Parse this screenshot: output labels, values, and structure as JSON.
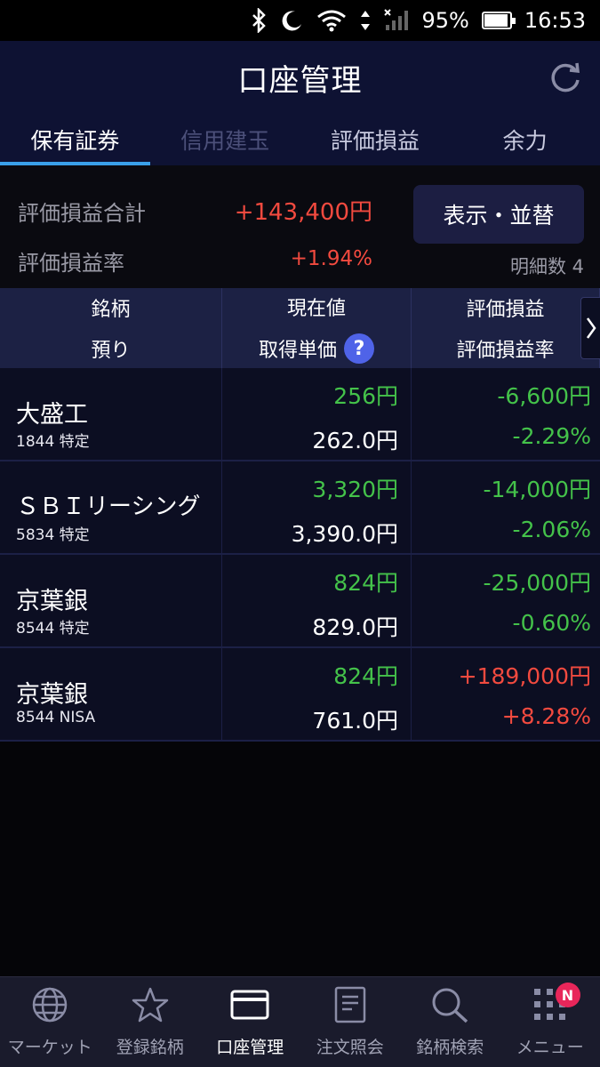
{
  "status_bar": {
    "battery": "95%",
    "time": "16:53",
    "battery_level": 0.95
  },
  "header": {
    "title": "口座管理"
  },
  "tabs": [
    {
      "label": "保有証券",
      "state": "active"
    },
    {
      "label": "信用建玉",
      "state": "disabled"
    },
    {
      "label": "評価損益",
      "state": "normal"
    },
    {
      "label": "余力",
      "state": "normal"
    }
  ],
  "summary": {
    "total_label": "評価損益合計",
    "total_value": "+143,400円",
    "rate_label": "評価損益率",
    "rate_value": "+1.94%",
    "display_button": "表示・並替",
    "count_text": "明細数 4"
  },
  "table": {
    "headers": {
      "col1_top": "銘柄",
      "col1_bottom": "預り",
      "col2_top": "現在値",
      "col2_bottom": "取得単価",
      "col3_top": "評価損益",
      "col3_bottom": "評価損益率",
      "help_icon": "?"
    },
    "rows": [
      {
        "name": "大盛工",
        "code": "1844 特定",
        "price": "256円",
        "cost": "262.0円",
        "pl": "-6,600円",
        "rate": "-2.29%",
        "pl_sign": "neg"
      },
      {
        "name": "ＳＢＩリーシング",
        "code": "5834 特定",
        "price": "3,320円",
        "cost": "3,390.0円",
        "pl": "-14,000円",
        "rate": "-2.06%",
        "pl_sign": "neg"
      },
      {
        "name": "京葉銀",
        "code": "8544 特定",
        "price": "824円",
        "cost": "829.0円",
        "pl": "-25,000円",
        "rate": "-0.60%",
        "pl_sign": "neg"
      },
      {
        "name": "京葉銀",
        "code": "8544 NISA",
        "price": "824円",
        "cost": "761.0円",
        "pl": "+189,000円",
        "rate": "+8.28%",
        "pl_sign": "pos"
      }
    ]
  },
  "bottom_nav": {
    "items": [
      {
        "label": "マーケット",
        "icon": "globe-icon"
      },
      {
        "label": "登録銘柄",
        "icon": "star-icon"
      },
      {
        "label": "口座管理",
        "icon": "card-icon"
      },
      {
        "label": "注文照会",
        "icon": "document-icon"
      },
      {
        "label": "銘柄検索",
        "icon": "search-icon"
      },
      {
        "label": "メニュー",
        "icon": "grid-icon"
      }
    ],
    "badge": "N"
  },
  "colors": {
    "positive": "#f24a3f",
    "negative": "#44c24a",
    "accent": "#3aa0ea",
    "header_bg": "#0e1233"
  }
}
